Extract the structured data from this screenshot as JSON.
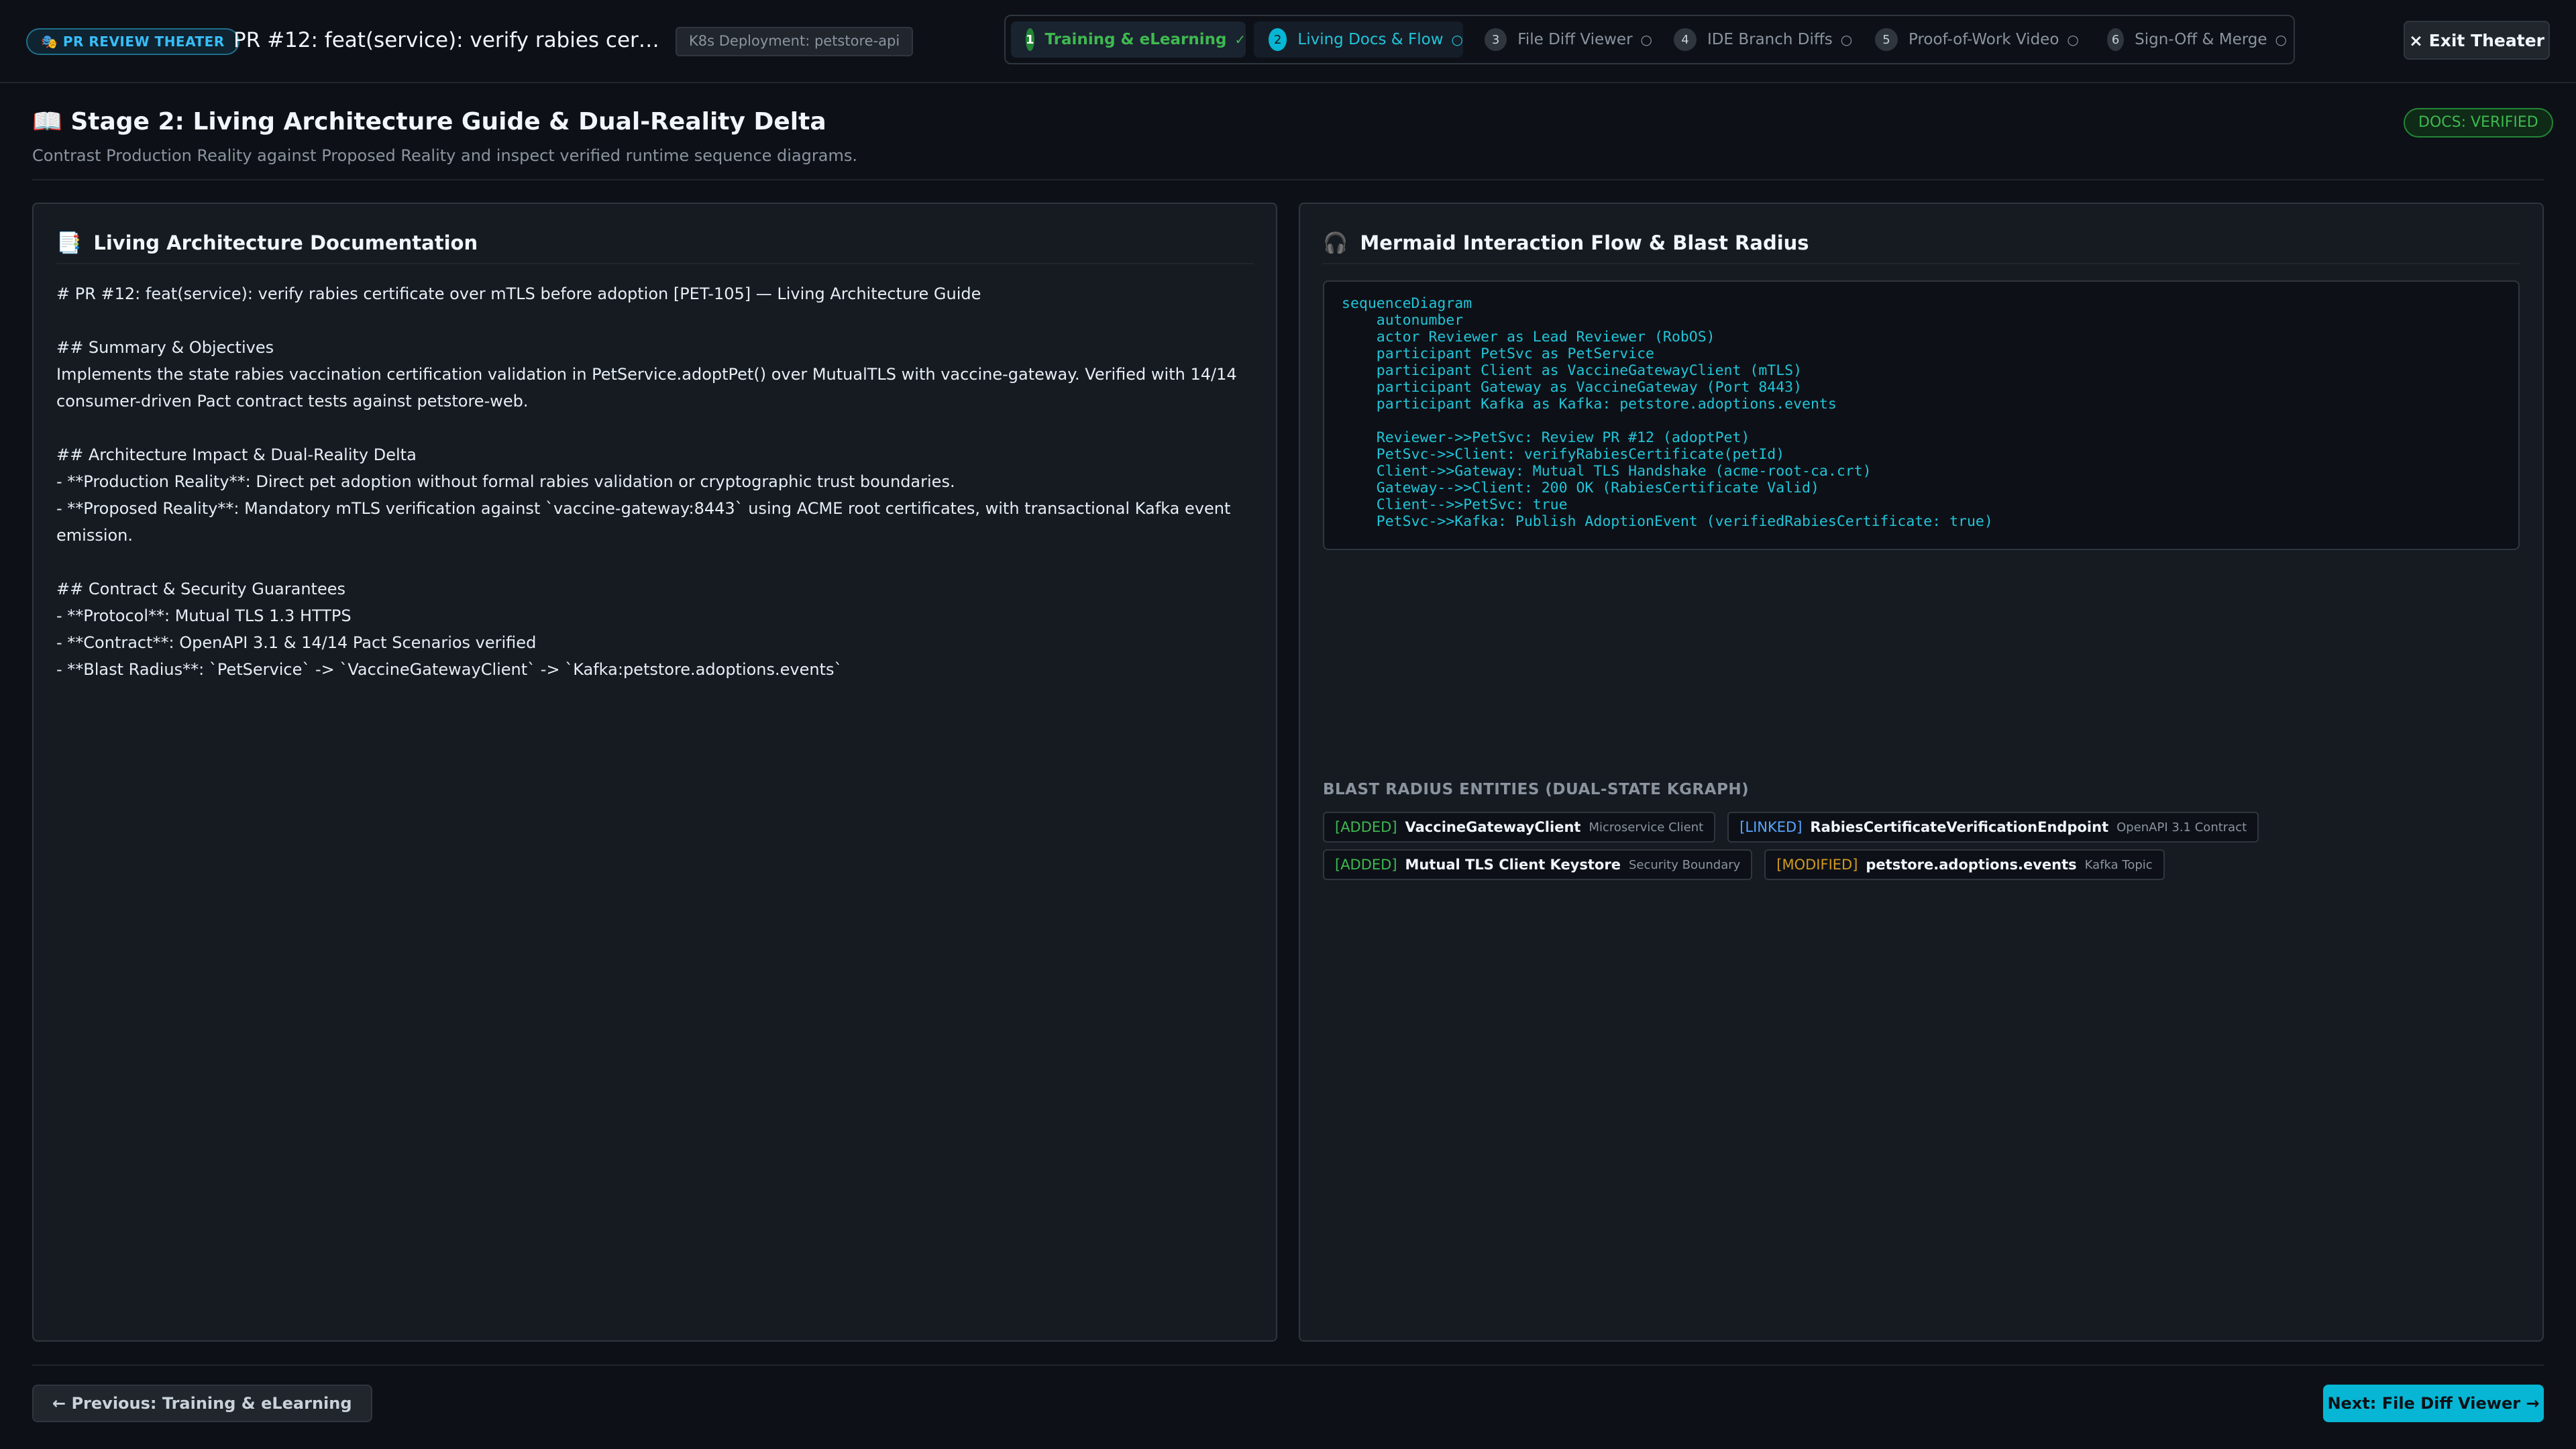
{
  "header": {
    "badge": "🎭 PR REVIEW THEATER",
    "pr_title": "PR #12: feat(service): verify rabies certificate over mTLS before adoption [PET-105]",
    "deployment": "K8s Deployment: petstore-api",
    "exit_label": "× Exit Theater"
  },
  "steps": [
    {
      "num": "1",
      "label": "Training & eLearning",
      "status": "✓",
      "state": "done"
    },
    {
      "num": "2",
      "label": "Living Docs & Flow",
      "status": "○",
      "state": "active"
    },
    {
      "num": "3",
      "label": "File Diff Viewer",
      "status": "○",
      "state": "pending"
    },
    {
      "num": "4",
      "label": "IDE Branch Diffs",
      "status": "○",
      "state": "pending"
    },
    {
      "num": "5",
      "label": "Proof-of-Work Video",
      "status": "○",
      "state": "pending"
    },
    {
      "num": "6",
      "label": "Sign-Off & Merge",
      "status": "○",
      "state": "pending"
    }
  ],
  "stage": {
    "title": "📖 Stage 2: Living Architecture Guide & Dual-Reality Delta",
    "subtitle": "Contrast Production Reality against Proposed Reality and inspect verified runtime sequence diagrams.",
    "status_badge": "DOCS: VERIFIED"
  },
  "left_panel": {
    "icon": "📑",
    "title": "Living Architecture Documentation",
    "body": "# PR #12: feat(service): verify rabies certificate over mTLS before adoption [PET-105] — Living Architecture Guide\n\n## Summary & Objectives\nImplements the state rabies vaccination certification validation in PetService.adoptPet() over MutualTLS with vaccine-gateway. Verified with 14/14 consumer-driven Pact contract tests against petstore-web.\n\n## Architecture Impact & Dual-Reality Delta\n- **Production Reality**: Direct pet adoption without formal rabies validation or cryptographic trust boundaries.\n- **Proposed Reality**: Mandatory mTLS verification against `vaccine-gateway:8443` using ACME root certificates, with transactional Kafka event emission.\n\n## Contract & Security Guarantees\n- **Protocol**: Mutual TLS 1.3 HTTPS\n- **Contract**: OpenAPI 3.1 & 14/14 Pact Scenarios verified\n- **Blast Radius**: `PetService` -> `VaccineGatewayClient` -> `Kafka:petstore.adoptions.events`"
  },
  "right_panel": {
    "icon": "🎧",
    "title": "Mermaid Interaction Flow & Blast Radius",
    "diagram": "sequenceDiagram\n    autonumber\n    actor Reviewer as Lead Reviewer (RobOS)\n    participant PetSvc as PetService\n    participant Client as VaccineGatewayClient (mTLS)\n    participant Gateway as VaccineGateway (Port 8443)\n    participant Kafka as Kafka: petstore.adoptions.events\n\n    Reviewer->>PetSvc: Review PR #12 (adoptPet)\n    PetSvc->>Client: verifyRabiesCertificate(petId)\n    Client->>Gateway: Mutual TLS Handshake (acme-root-ca.crt)\n    Gateway-->>Client: 200 OK (RabiesCertificate Valid)\n    Client-->>PetSvc: true\n    PetSvc->>Kafka: Publish AdoptionEvent (verifiedRabiesCertificate: true)",
    "blast_title": "BLAST RADIUS ENTITIES (DUAL-STATE KGRAPH)",
    "entities": [
      {
        "tag": "[ADDED]",
        "name": "VaccineGatewayClient",
        "kind": "Microservice Client"
      },
      {
        "tag": "[LINKED]",
        "name": "RabiesCertificateVerificationEndpoint",
        "kind": "OpenAPI 3.1 Contract"
      },
      {
        "tag": "[ADDED]",
        "name": "Mutual TLS Client Keystore",
        "kind": "Security Boundary"
      },
      {
        "tag": "[MODIFIED]",
        "name": "petstore.adoptions.events",
        "kind": "Kafka Topic"
      }
    ]
  },
  "footer": {
    "prev_label": "← Previous: Training & eLearning",
    "next_label": "Next: File Diff Viewer →"
  },
  "colors": {
    "background": "#0d1117",
    "accent": "#06b6d4",
    "success": "#3fb950",
    "linked": "#58a6ff",
    "modified": "#d29922"
  }
}
